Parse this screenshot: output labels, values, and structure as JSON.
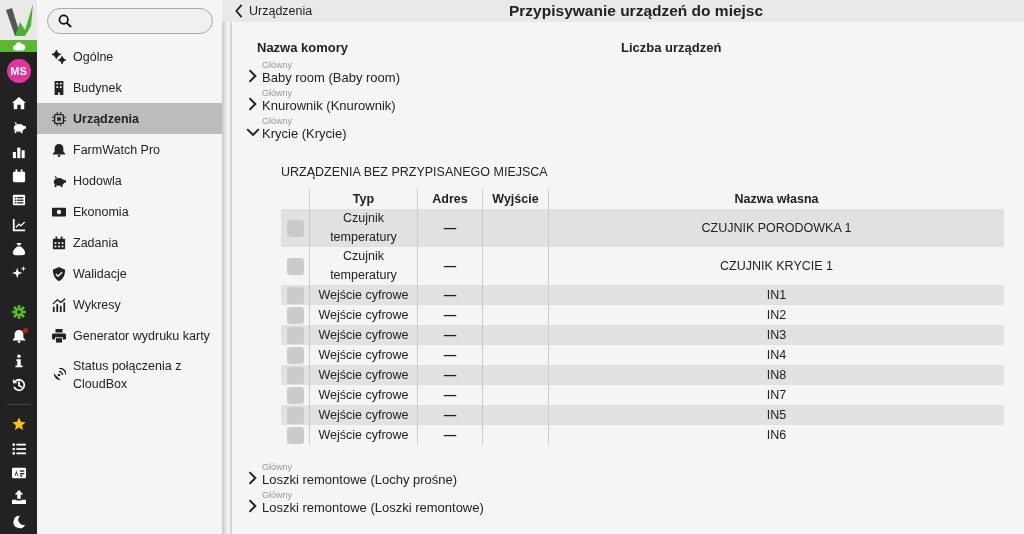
{
  "rail": {
    "avatar": "MS",
    "items": [
      {
        "selected": false
      },
      {
        "selected": false
      },
      {
        "selected": false
      },
      {
        "selected": false
      },
      {
        "selected": false
      },
      {
        "selected": false
      },
      {
        "selected": false
      },
      {
        "selected": false
      },
      {
        "selected": true
      },
      {
        "selected": false,
        "notification": true
      },
      {
        "selected": false
      },
      {
        "selected": false
      },
      {
        "selected": false
      },
      {
        "selected": false
      },
      {
        "selected": false
      },
      {
        "selected": false
      },
      {
        "selected": false
      }
    ]
  },
  "sidebar": {
    "items": [
      {
        "label": "Ogólne",
        "selected": false
      },
      {
        "label": "Budynek",
        "selected": false
      },
      {
        "label": "Urządzenia",
        "selected": true
      },
      {
        "label": "FarmWatch Pro",
        "selected": false
      },
      {
        "label": "Hodowla",
        "selected": false
      },
      {
        "label": "Ekonomia",
        "selected": false
      },
      {
        "label": "Zadania",
        "selected": false
      },
      {
        "label": "Walidacje",
        "selected": false
      },
      {
        "label": "Wykresy",
        "selected": false
      },
      {
        "label": "Generator wydruku karty",
        "selected": false
      },
      {
        "label": "Status połączenia z CloudBox",
        "selected": false
      }
    ]
  },
  "header": {
    "back": "Urządzenia",
    "title": "Przypisywanie urządzeń do miejsc"
  },
  "columns": [
    "Nazwa komory",
    "Liczba urządzeń"
  ],
  "rooms": [
    {
      "group": "Główny",
      "name": "Baby room (Baby room)",
      "expanded": false
    },
    {
      "group": "Główny",
      "name": "Knurownik (Knurownik)",
      "expanded": false
    },
    {
      "group": "Główny",
      "name": "Krycie (Krycie)",
      "expanded": true,
      "unassigned": {
        "title": "URZĄDZENIA BEZ PRZYPISANEGO MIEJSCA",
        "columns": [
          "Typ",
          "Adres",
          "Wyjście",
          "Nazwa własna"
        ],
        "rows": [
          {
            "checked": false,
            "type": "Czujnik temperatury",
            "address": "—",
            "name": "CZUJNIK PORODOWKA 1"
          },
          {
            "checked": false,
            "type": "Czujnik temperatury",
            "address": "—",
            "name": "CZUJNIK KRYCIE 1"
          },
          {
            "checked": false,
            "type": "Wejście cyfrowe",
            "address": "—",
            "name": "IN1"
          },
          {
            "checked": false,
            "type": "Wejście cyfrowe",
            "address": "—",
            "name": "IN2"
          },
          {
            "checked": false,
            "type": "Wejście cyfrowe",
            "address": "—",
            "name": "IN3"
          },
          {
            "checked": false,
            "type": "Wejście cyfrowe",
            "address": "—",
            "name": "IN4"
          },
          {
            "checked": false,
            "type": "Wejście cyfrowe",
            "address": "—",
            "name": "IN8"
          },
          {
            "checked": false,
            "type": "Wejście cyfrowe",
            "address": "—",
            "name": "IN7"
          },
          {
            "checked": false,
            "type": "Wejście cyfrowe",
            "address": "—",
            "name": "IN5"
          },
          {
            "checked": false,
            "type": "Wejście cyfrowe",
            "address": "—",
            "name": "IN6"
          }
        ]
      }
    },
    {
      "group": "Główny",
      "name": "Loszki remontowe (Lochy prośne)",
      "expanded": false
    },
    {
      "group": "Główny",
      "name": "Loszki remontowe (Loszki remontowe)",
      "expanded": false
    }
  ]
}
